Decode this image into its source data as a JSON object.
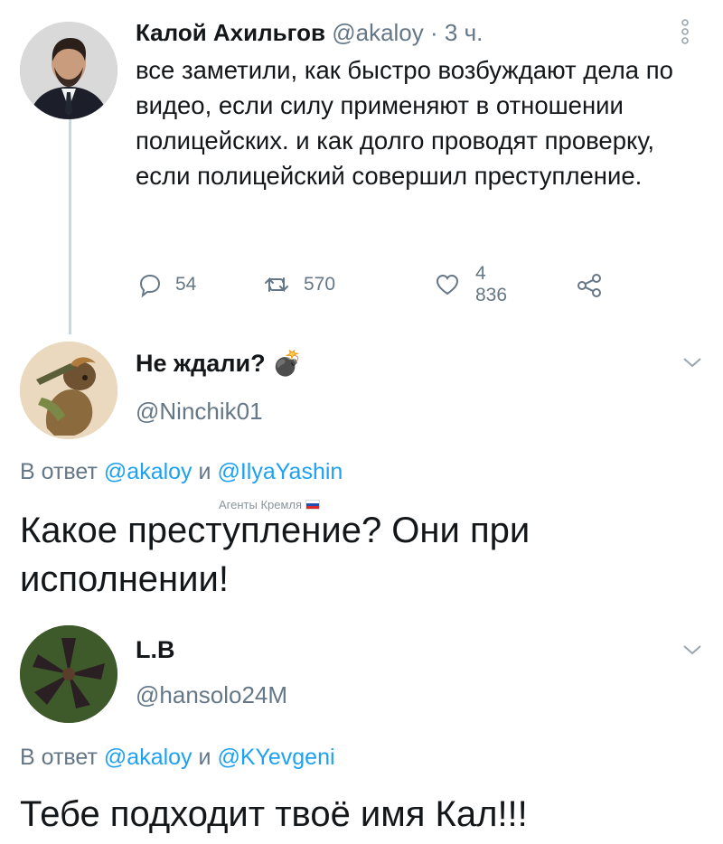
{
  "tweet": {
    "author_name": "Калой Ахильгов",
    "author_handle": "@akaloy",
    "time": "· 3 ч.",
    "text": "все заметили, как быстро возбуждают дела по видео, если силу применяют в отношении полицейских. и как долго проводят проверку, если полицейский совершил преступление.",
    "actions": {
      "replies": "54",
      "retweets": "570",
      "likes": "4 836"
    }
  },
  "replies": [
    {
      "name": "Не ждали? 💣",
      "handle": "@Ninchik01",
      "reply_to_prefix": "В ответ",
      "reply_to_1": "@akaloy",
      "reply_to_and": "и",
      "reply_to_2": "@IlyaYashin",
      "label": "Агенты Кремля",
      "text": "Какое преступление? Они при исполнении!"
    },
    {
      "name": "L.B",
      "handle": "@hansolo24M",
      "reply_to_prefix": "В ответ",
      "reply_to_1": "@akaloy",
      "reply_to_and": "и",
      "reply_to_2": "@KYevgeni",
      "text": "Тебе подходит твоё имя Кал!!!"
    }
  ],
  "icons": {
    "reply": "speech-bubble-icon",
    "retweet": "retweet-icon",
    "like": "heart-icon",
    "share": "share-icon",
    "more": "vertical-dots-icon",
    "chevron": "chevron-down-icon"
  },
  "colors": {
    "accent": "#1da1f2",
    "secondary_text": "#657786",
    "thread_line": "#ccd6dd"
  }
}
